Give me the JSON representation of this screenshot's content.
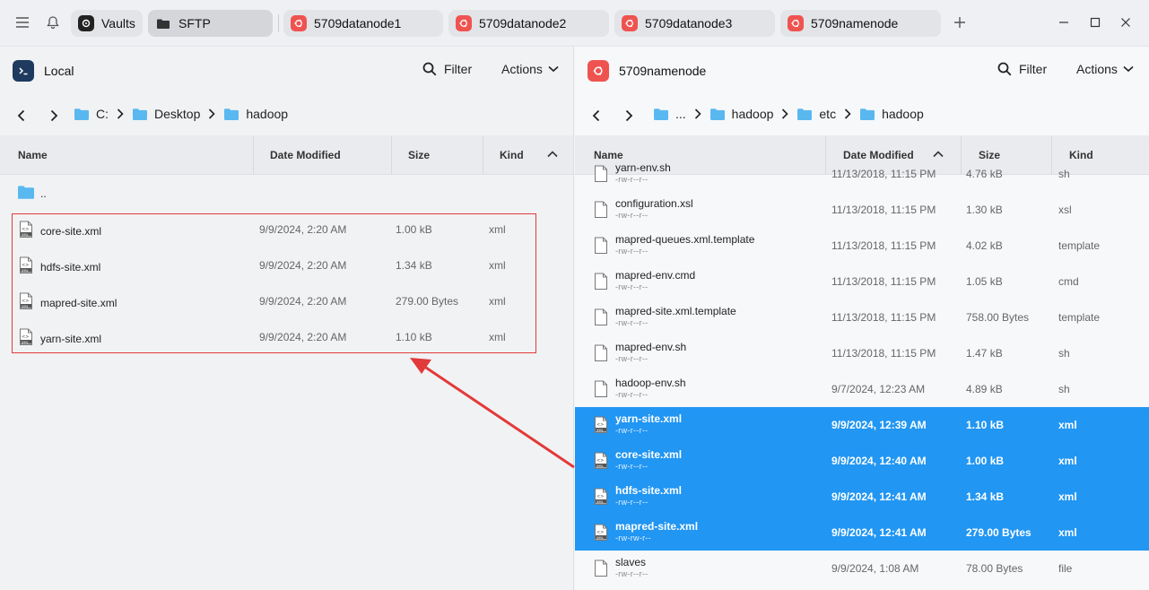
{
  "tabs": {
    "vaults_label": "Vaults",
    "sftp_label": "SFTP",
    "hosts": [
      "5709datanode1",
      "5709datanode2",
      "5709datanode3",
      "5709namenode"
    ]
  },
  "local": {
    "title": "Local",
    "filter_label": "Filter",
    "actions_label": "Actions",
    "breadcrumb": [
      "C:",
      "Desktop",
      "hadoop"
    ],
    "columns": [
      "Name",
      "Date Modified",
      "Size",
      "Kind"
    ],
    "parent_label": "..",
    "files": [
      {
        "name": "core-site.xml",
        "date": "9/9/2024, 2:20 AM",
        "size": "1.00 kB",
        "kind": "xml"
      },
      {
        "name": "hdfs-site.xml",
        "date": "9/9/2024, 2:20 AM",
        "size": "1.34 kB",
        "kind": "xml"
      },
      {
        "name": "mapred-site.xml",
        "date": "9/9/2024, 2:20 AM",
        "size": "279.00 Bytes",
        "kind": "xml"
      },
      {
        "name": "yarn-site.xml",
        "date": "9/9/2024, 2:20 AM",
        "size": "1.10 kB",
        "kind": "xml"
      }
    ]
  },
  "remote": {
    "title": "5709namenode",
    "filter_label": "Filter",
    "actions_label": "Actions",
    "breadcrumb": [
      "...",
      "hadoop",
      "etc",
      "hadoop"
    ],
    "columns": [
      "Name",
      "Date Modified",
      "Size",
      "Kind"
    ],
    "files": [
      {
        "name": "yarn-env.sh",
        "perm": "-rw-r--r--",
        "date": "11/13/2018, 11:15 PM",
        "size": "4.76 kB",
        "kind": "sh",
        "type": "doc"
      },
      {
        "name": "configuration.xsl",
        "perm": "-rw-r--r--",
        "date": "11/13/2018, 11:15 PM",
        "size": "1.30 kB",
        "kind": "xsl",
        "type": "doc"
      },
      {
        "name": "mapred-queues.xml.template",
        "perm": "-rw-r--r--",
        "date": "11/13/2018, 11:15 PM",
        "size": "4.02 kB",
        "kind": "template",
        "type": "doc"
      },
      {
        "name": "mapred-env.cmd",
        "perm": "-rw-r--r--",
        "date": "11/13/2018, 11:15 PM",
        "size": "1.05 kB",
        "kind": "cmd",
        "type": "doc"
      },
      {
        "name": "mapred-site.xml.template",
        "perm": "-rw-r--r--",
        "date": "11/13/2018, 11:15 PM",
        "size": "758.00 Bytes",
        "kind": "template",
        "type": "doc"
      },
      {
        "name": "mapred-env.sh",
        "perm": "-rw-r--r--",
        "date": "11/13/2018, 11:15 PM",
        "size": "1.47 kB",
        "kind": "sh",
        "type": "doc"
      },
      {
        "name": "hadoop-env.sh",
        "perm": "-rw-r--r--",
        "date": "9/7/2024, 12:23 AM",
        "size": "4.89 kB",
        "kind": "sh",
        "type": "doc"
      },
      {
        "name": "yarn-site.xml",
        "perm": "-rw-r--r--",
        "date": "9/9/2024, 12:39 AM",
        "size": "1.10 kB",
        "kind": "xml",
        "type": "xml",
        "selected": true
      },
      {
        "name": "core-site.xml",
        "perm": "-rw-r--r--",
        "date": "9/9/2024, 12:40 AM",
        "size": "1.00 kB",
        "kind": "xml",
        "type": "xml",
        "selected": true
      },
      {
        "name": "hdfs-site.xml",
        "perm": "-rw-r--r--",
        "date": "9/9/2024, 12:41 AM",
        "size": "1.34 kB",
        "kind": "xml",
        "type": "xml",
        "selected": true
      },
      {
        "name": "mapred-site.xml",
        "perm": "-rw-rw-r--",
        "date": "9/9/2024, 12:41 AM",
        "size": "279.00 Bytes",
        "kind": "xml",
        "type": "xml",
        "selected": true
      },
      {
        "name": "slaves",
        "perm": "-rw-r--r--",
        "date": "9/9/2024, 1:08 AM",
        "size": "78.00 Bytes",
        "kind": "file",
        "type": "doc"
      }
    ]
  },
  "colors": {
    "selection": "#2196f3",
    "annotation": "#e23a3a",
    "ubuntu": "#ef5350",
    "folder": "#5ab8f0"
  }
}
